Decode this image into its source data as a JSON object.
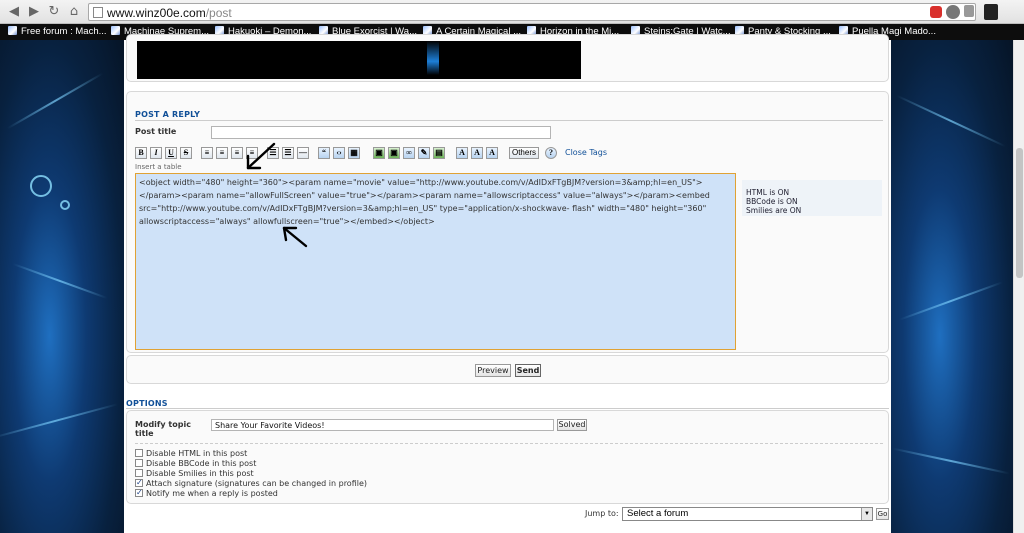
{
  "browser": {
    "url_host": "www.winz00e.com",
    "url_path": "/post",
    "bookmarks": [
      {
        "label": "Free forum : Mach..."
      },
      {
        "label": "Machinae Suprem..."
      },
      {
        "label": "Hakuoki – Demon..."
      },
      {
        "label": "Blue Exorcist | Wa..."
      },
      {
        "label": "A Certain Magical ..."
      },
      {
        "label": "Horizon in the Mi..."
      },
      {
        "label": "Steins;Gate | Watc..."
      },
      {
        "label": "Panty & Stocking ..."
      },
      {
        "label": "Puella Magi Mado..."
      }
    ],
    "icons": [
      "back-icon",
      "forward-icon",
      "reload-icon",
      "home-icon",
      "page-icon",
      "adblock-icon",
      "extension-icon",
      "menu-icon"
    ]
  },
  "post_reply": {
    "section_title": "POST A REPLY",
    "post_title_label": "Post title",
    "post_title_value": "",
    "others_label": "Others",
    "close_tags_label": "Close Tags",
    "insert_hint": "Insert a table",
    "message": "<object width=\"480\" height=\"360\"><param name=\"movie\" value=\"http://www.youtube.com/v/AdIDxFTgBJM?version=3&amp;hl=en_US\"></param><param name=\"allowFullScreen\" value=\"true\"></param><param name=\"allowscriptaccess\" value=\"always\"></param><embed src=\"http://www.youtube.com/v/AdIDxFTgBJM?version=3&amp;hl=en_US\" type=\"application/x-shockwave- flash\" width=\"480\" height=\"360\" allowscriptaccess=\"always\" allowfullscreen=\"true\"></embed></object>",
    "status": {
      "html": "HTML is ON",
      "bbcode": "BBCode is ON",
      "smilies": "Smilies are ON"
    },
    "preview_label": "Preview",
    "send_label": "Send"
  },
  "options": {
    "section_title": "OPTIONS",
    "modify_topic_label": "Modify topic title",
    "topic_title_value": "Share Your Favorite Videos!",
    "solved_label": "Solved",
    "checkboxes": [
      {
        "label": "Disable HTML in this post",
        "checked": false
      },
      {
        "label": "Disable BBCode in this post",
        "checked": false
      },
      {
        "label": "Disable Smilies in this post",
        "checked": false
      },
      {
        "label": "Attach signature (signatures can be changed in profile)",
        "checked": true
      },
      {
        "label": "Notify me when a reply is posted",
        "checked": true
      }
    ]
  },
  "jump": {
    "label": "Jump to:",
    "selected": "Select a forum",
    "go_label": "Go"
  },
  "colors": {
    "accent": "#115098",
    "editor_bg": "#cfe2f8",
    "editor_border": "#e0a234"
  }
}
